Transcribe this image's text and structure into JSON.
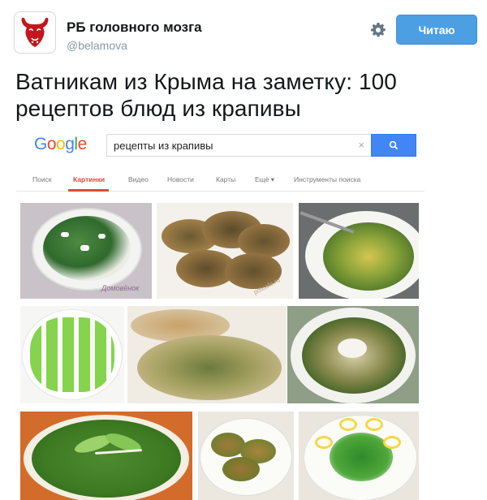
{
  "tweet": {
    "user_name": "РБ головного мозга",
    "user_handle": "@belamova",
    "follow_label": "Читаю",
    "text": "Ватникам из Крыма на заметку: 100 рецептов блюд из крапивы"
  },
  "colors": {
    "follow_button": "#4d9fe4",
    "avatar_bison": "#c4161c",
    "google_blue": "#4285f4",
    "google_red": "#ea4335",
    "google_yellow": "#fbbc05",
    "google_green": "#34a853",
    "active_tab": "#dd4b39"
  },
  "icons": {
    "avatar": "red-bison-logo",
    "settings": "gear-icon",
    "search": "magnifier-icon",
    "clear": "close-icon"
  },
  "google": {
    "logo_letters": [
      "G",
      "o",
      "o",
      "g",
      "l",
      "e"
    ],
    "query": "рецепты из крапивы",
    "clear_glyph": "×",
    "tabs": [
      "Поиск",
      "Картинки",
      "Видео",
      "Новости",
      "Карты",
      "Ещё ▾",
      "Инструменты поиска"
    ],
    "active_tab": "Картинки"
  },
  "images": [
    {
      "description": "nettle salad with eggs"
    },
    {
      "description": "nettle cutlets"
    },
    {
      "description": "nettle pasta with fork"
    },
    {
      "description": "green stuffed eggs"
    },
    {
      "description": "nettle omelette slices"
    },
    {
      "description": "nettle soup with sour cream"
    },
    {
      "description": "nettle cream soup with leaves"
    },
    {
      "description": "fried nettle patties"
    },
    {
      "description": "nettle salad with egg halves"
    }
  ],
  "watermarks": {
    "img1": "Домовёнок",
    "img2": "potcafe.ru"
  }
}
